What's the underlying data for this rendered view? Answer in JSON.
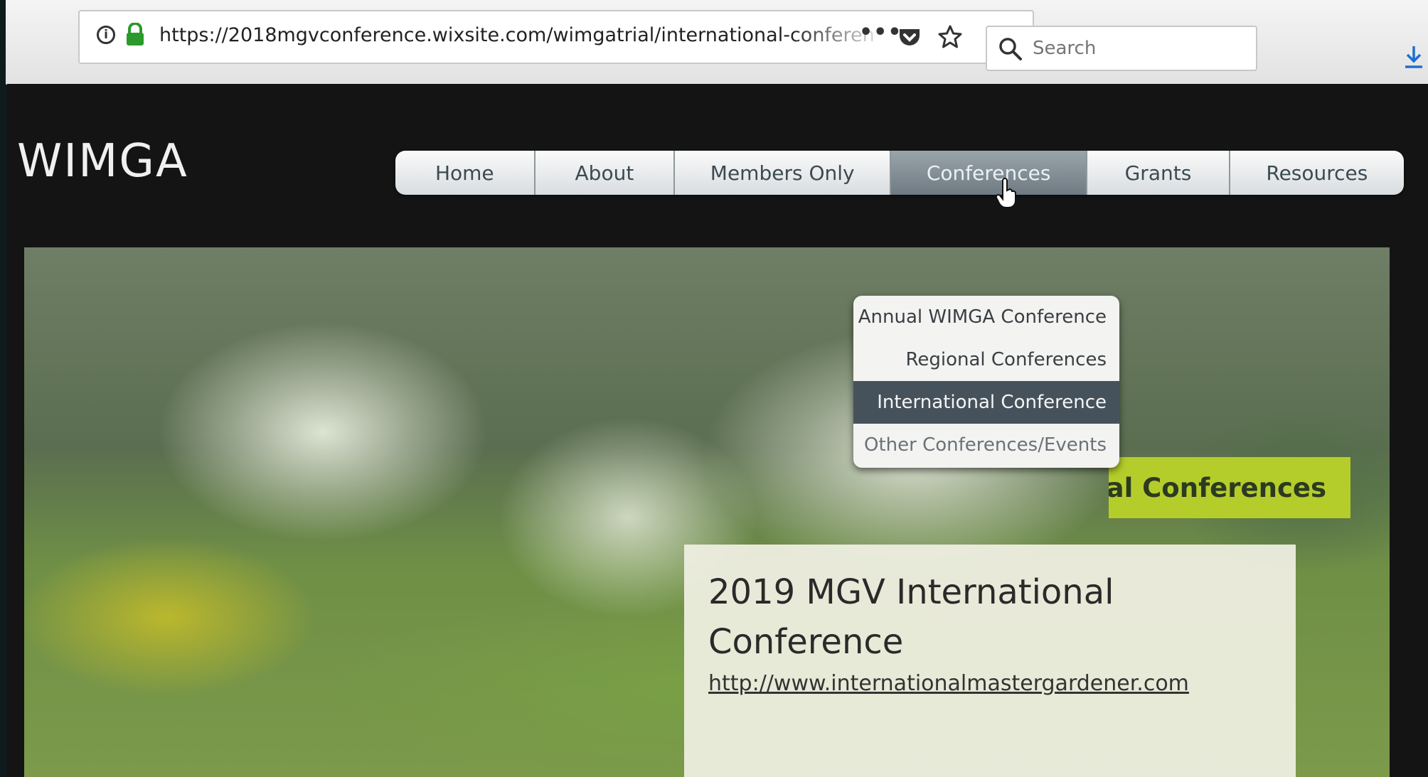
{
  "browser": {
    "url": "https://2018mgvconference.wixsite.com/wimgatrial/international-conferen",
    "search_placeholder": "Search"
  },
  "site": {
    "logo": "WIMGA",
    "nav": [
      "Home",
      "About",
      "Members Only",
      "Conferences",
      "Grants",
      "Resources"
    ],
    "active_nav": "Conferences",
    "dropdown": [
      "Annual WIMGA Conference",
      "Regional Conferences",
      "International Conference",
      "Other Conferences/Events"
    ],
    "selected_dropdown": "International Conference",
    "hero": {
      "ribbon_text": "al Conferences",
      "card_title": "2019 MGV International Conference",
      "card_link": "http://www.internationalmastergardener.com"
    }
  },
  "colors": {
    "ribbon": "#b5cd2a",
    "dropdown_selected": "#46525b",
    "nav_active": "#7f8a92"
  }
}
